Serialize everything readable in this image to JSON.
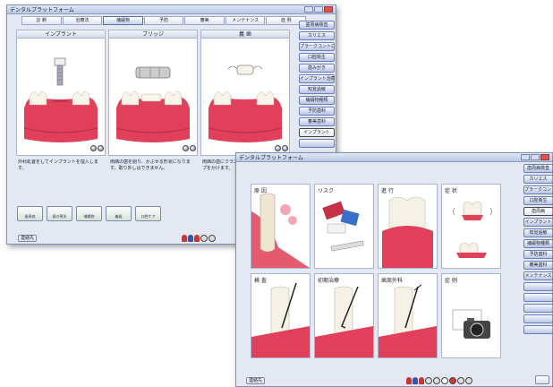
{
  "window1": {
    "title": "デンタルプラットフォーム",
    "tabs": [
      "診 断",
      "治療法",
      "補綴物",
      "予防",
      "審美",
      "メンテナンス",
      "症 例"
    ],
    "active_tab": 2,
    "panels": [
      {
        "title": "インプラント",
        "desc": "外科処置をしてインプラントを埋入します。"
      },
      {
        "title": "ブリッジ",
        "desc": "両隣の歯を削り、かぶせる形状になります。取り外しはできません。"
      },
      {
        "title": "義 歯",
        "desc": "両隣の歯にクラスプをかけます。"
      }
    ],
    "sidebar": [
      "歯周病検査",
      "カリエス",
      "プラークコントロール",
      "口腔衛生",
      "歯みがき",
      "インプラント治療",
      "知覚過敏",
      "補綴物種類",
      "予防歯科",
      "審美歯科",
      "インプラント",
      ""
    ],
    "sidebar_highlight": 10,
    "thumbs": [
      "歯周病",
      "歯の喪失",
      "補綴物",
      "義歯",
      "口腔ケア"
    ],
    "footer_button": "連絡先"
  },
  "window2": {
    "title": "デンタルプラットフォーム",
    "tiles": [
      "原 因",
      "リスク",
      "進 行",
      "症 状",
      "検 査",
      "初期治療",
      "歯周外科",
      "症 例"
    ],
    "sidebar": [
      "歯周病検査",
      "カリエス",
      "プラークコントロール",
      "口腔衛生",
      "歯周病",
      "インプラント",
      "知覚過敏",
      "補綴物種類",
      "予防歯科",
      "審美歯科",
      "メンテナンス",
      "",
      "",
      "",
      "",
      ""
    ],
    "sidebar_highlight": 4,
    "footer_button": "連絡先"
  },
  "colors": {
    "gum": "#e0405a",
    "tooth": "#f7f4ea",
    "accent": "#4c5fa0"
  }
}
